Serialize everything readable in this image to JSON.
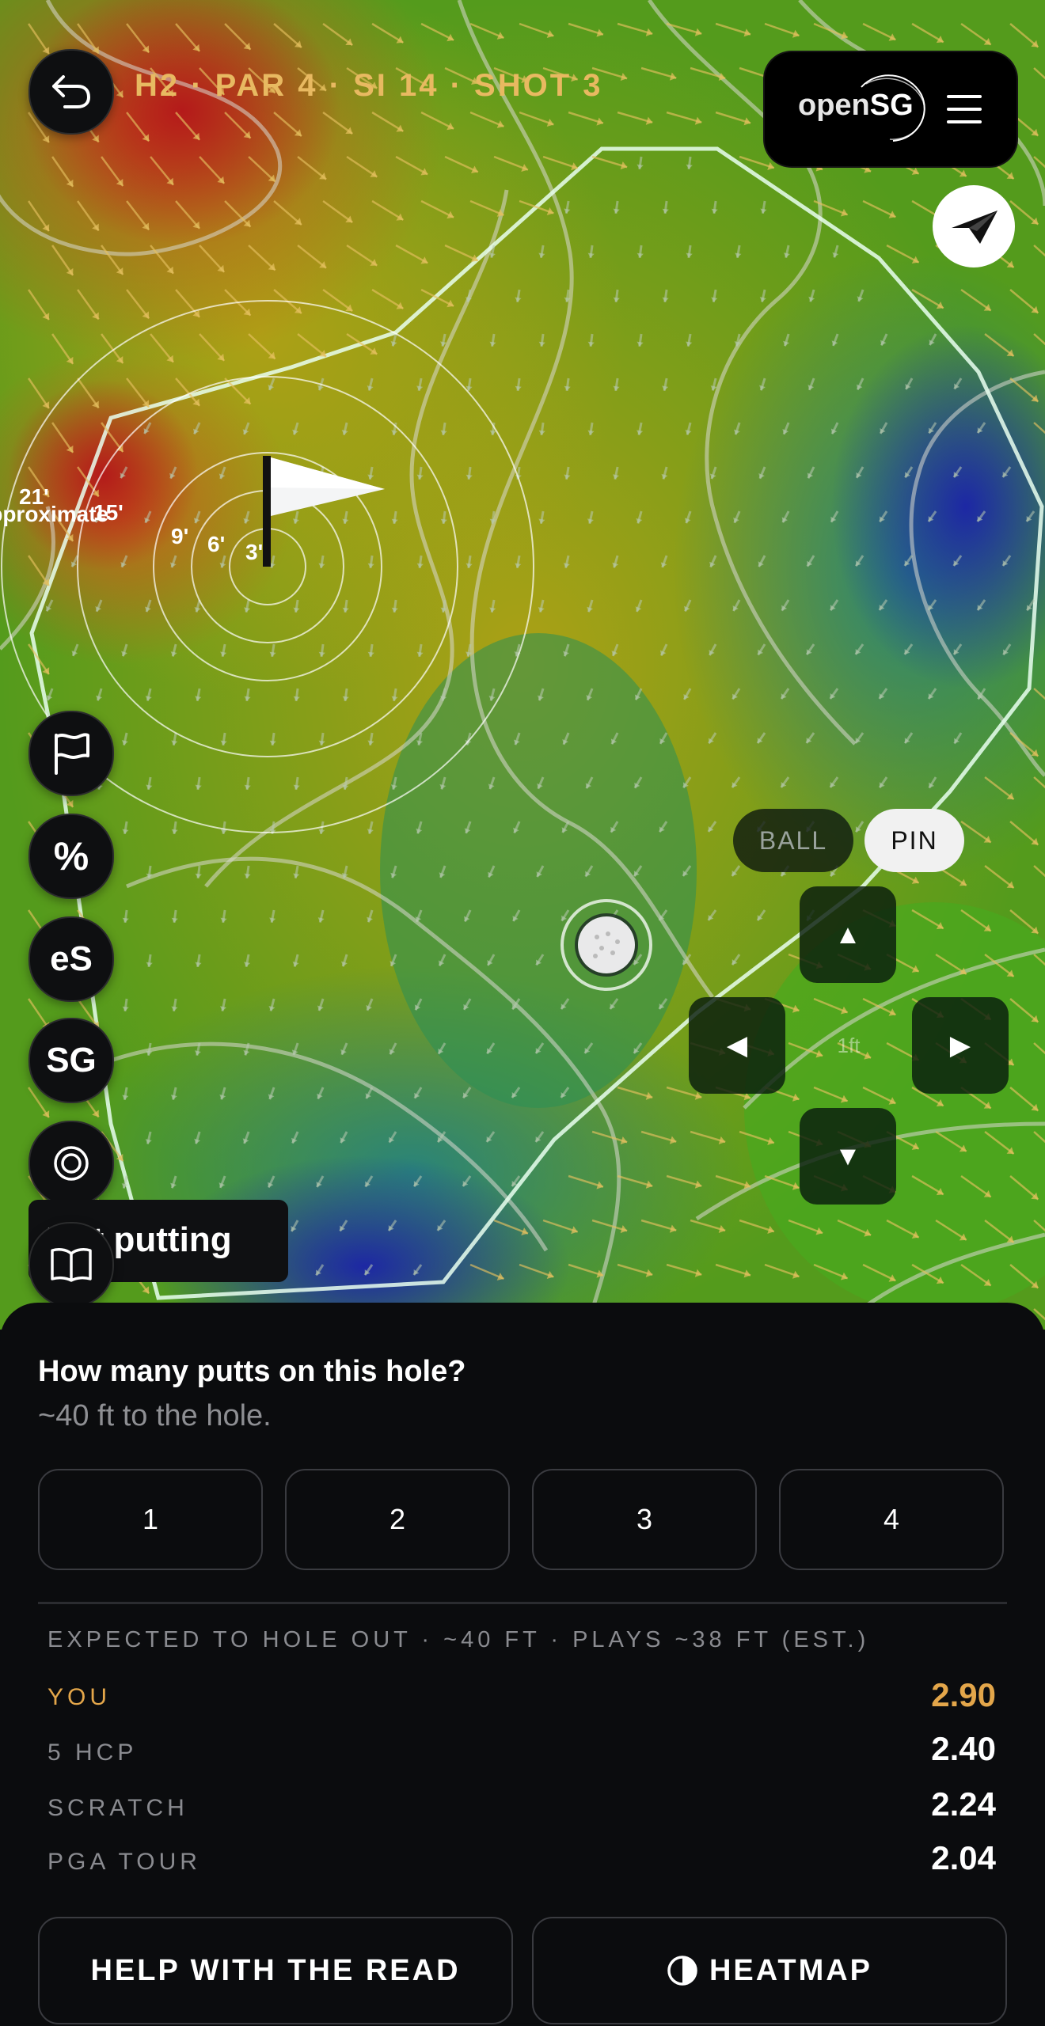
{
  "header": {
    "hole_title": "H2 · PAR 4 · SI 14 · SHOT 3",
    "brand_prefix": "open",
    "brand_suffix": "SG"
  },
  "map": {
    "distance_rings": [
      "3'",
      "6'",
      "9'",
      "15'",
      "21'"
    ],
    "approx_label": "Approximate",
    "nudge_unit": "1ft",
    "target_toggle": {
      "ball": "BALL",
      "pin": "PIN",
      "selected": "PIN"
    }
  },
  "side_tools": {
    "percent": "%",
    "es": "eS",
    "sg": "SG"
  },
  "toast": "Not putting",
  "question": {
    "title": "How many putts on this hole?",
    "subtitle": "~40 ft to the hole.",
    "options": [
      "1",
      "2",
      "3",
      "4"
    ]
  },
  "expected": {
    "header": "EXPECTED TO HOLE OUT · ~40 FT · PLAYS ~38 FT (EST.)",
    "rows": [
      {
        "label": "YOU",
        "value": "2.90"
      },
      {
        "label": "5 HCP",
        "value": "2.40"
      },
      {
        "label": "SCRATCH",
        "value": "2.24"
      },
      {
        "label": "PGA TOUR",
        "value": "2.04"
      }
    ]
  },
  "actions": {
    "help": "HELP WITH THE READ",
    "heatmap": "HEATMAP"
  },
  "colors": {
    "accent": "#e3a64a",
    "sheet_bg": "#0b0c0e",
    "heat_hot": "#b61c14",
    "heat_mid": "#7cad16",
    "heat_cool": "#1c2fa8"
  }
}
